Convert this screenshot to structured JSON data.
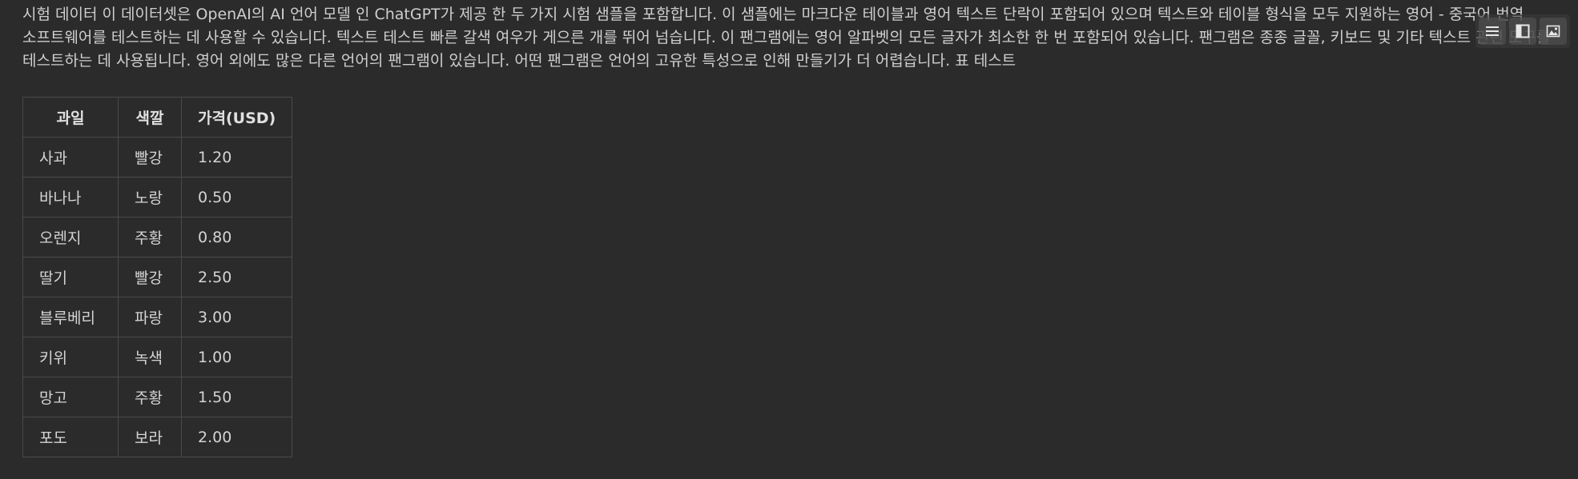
{
  "paragraph": "시험 데이터 이 데이터셋은 OpenAI의 AI 언어 모델 인 ChatGPT가 제공 한 두 가지 시험 샘플을 포함합니다. 이 샘플에는 마크다운 테이블과 영어 텍스트 단락이 포함되어 있으며 텍스트와 테이블 형식을 모두 지원하는 영어 - 중국어 번역 소프트웨어를 테스트하는 데 사용할 수 있습니다. 텍스트 테스트 빠른 갈색 여우가 게으른 개를 뛰어 넘습니다. 이 팬그램에는 영어 알파벳의 모든 글자가 최소한 한 번 포함되어 있습니다. 팬그램은 종종 글꼴, 키보드 및 기타 텍스트 관련 도구를 테스트하는 데 사용됩니다. 영어 외에도 많은 다른 언어의 팬그램이 있습니다. 어떤 팬그램은 언어의 고유한 특성으로 인해 만들기가 더 어렵습니다. 표 테스트",
  "toolbar": {
    "icons": [
      "menu-lines-icon",
      "split-panel-icon",
      "image-icon"
    ]
  },
  "table": {
    "headers": [
      "과일",
      "색깔",
      "가격(USD)"
    ],
    "rows": [
      [
        "사과",
        "빨강",
        "1.20"
      ],
      [
        "바나나",
        "노랑",
        "0.50"
      ],
      [
        "오렌지",
        "주황",
        "0.80"
      ],
      [
        "딸기",
        "빨강",
        "2.50"
      ],
      [
        "블루베리",
        "파랑",
        "3.00"
      ],
      [
        "키위",
        "녹색",
        "1.00"
      ],
      [
        "망고",
        "주황",
        "1.50"
      ],
      [
        "포도",
        "보라",
        "2.00"
      ]
    ]
  },
  "colors": {
    "background": "#2b2b2b",
    "text": "#d4d4d4",
    "border": "#4a4a4a"
  }
}
